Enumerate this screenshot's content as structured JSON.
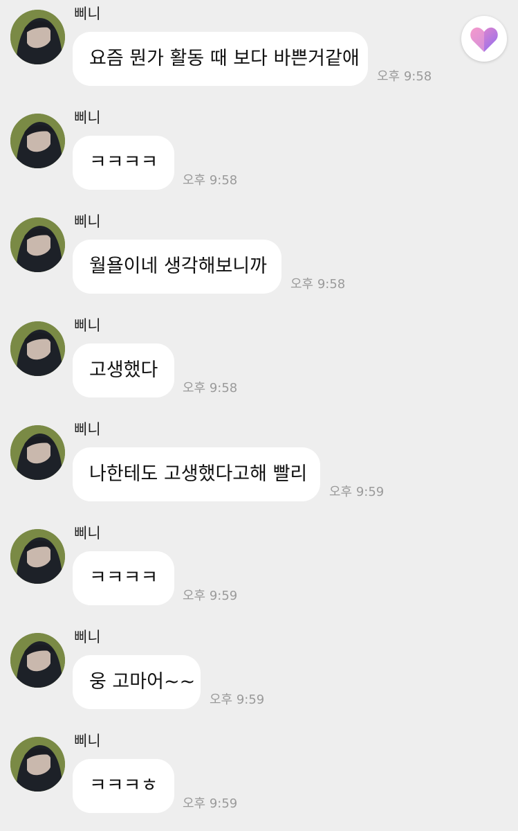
{
  "sender_name": "삐니",
  "messages": [
    {
      "text": "요즘 뭔가 활동 때 보다 바쁜거같애",
      "time": "오후 9:58"
    },
    {
      "text": "ㅋㅋㅋㅋ",
      "time": "오후 9:58"
    },
    {
      "text": "월욜이네 생각해보니까",
      "time": "오후 9:58"
    },
    {
      "text": "고생했다",
      "time": "오후 9:58"
    },
    {
      "text": "나한테도 고생했다고해 빨리",
      "time": "오후 9:59"
    },
    {
      "text": "ㅋㅋㅋㅋ",
      "time": "오후 9:59"
    },
    {
      "text": "웅 고마어~~",
      "time": "오후 9:59"
    },
    {
      "text": "ㅋㅋㅋㅎ",
      "time": "오후 9:59"
    }
  ],
  "floating_button": {
    "icon": "heart-icon"
  },
  "colors": {
    "background": "#eeeeee",
    "bubble": "#ffffff",
    "timestamp": "#9a9a9a",
    "heart_gradient_start": "#f38bc4",
    "heart_gradient_end": "#8e6df0"
  }
}
